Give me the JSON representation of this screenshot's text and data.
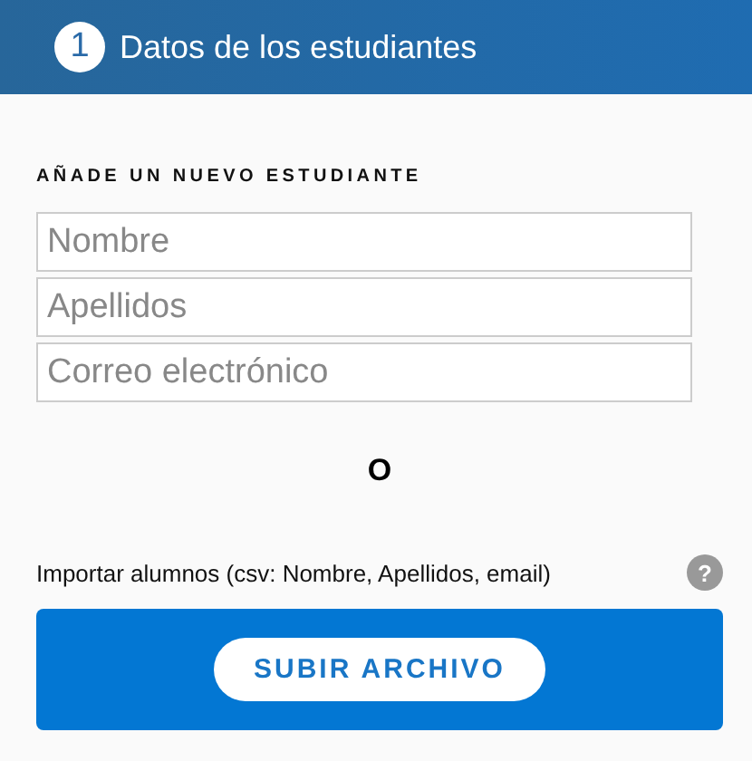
{
  "header": {
    "step": "1",
    "title": "Datos de los estudiantes"
  },
  "section_title": "AÑADE UN NUEVO ESTUDIANTE",
  "fields": [
    {
      "placeholder": "Nombre"
    },
    {
      "placeholder": "Apellidos"
    },
    {
      "placeholder": "Correo electrónico"
    }
  ],
  "separator": "O",
  "import": {
    "label": "Importar alumnos (csv: Nombre, Apellidos, email)",
    "help": "?",
    "button": "SUBIR ARCHIVO"
  }
}
